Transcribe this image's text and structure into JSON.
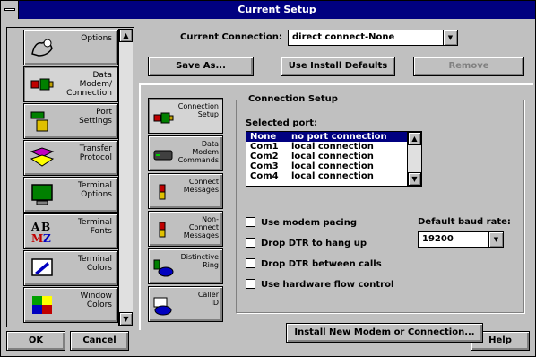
{
  "window": {
    "title": "Current Setup"
  },
  "left_panel": {
    "items": [
      {
        "label": "Options",
        "icon": "options-icon"
      },
      {
        "label": "Data\nModem/\nConnection",
        "icon": "modem-connection-icon",
        "selected": true
      },
      {
        "label": "Port\nSettings",
        "icon": "port-settings-icon"
      },
      {
        "label": "Transfer\nProtocol",
        "icon": "transfer-protocol-icon"
      },
      {
        "label": "Terminal\nOptions",
        "icon": "terminal-options-icon"
      },
      {
        "label": "Terminal\nFonts",
        "icon": "terminal-fonts-icon"
      },
      {
        "label": "Terminal\nColors",
        "icon": "terminal-colors-icon"
      },
      {
        "label": "Window\nColors",
        "icon": "window-colors-icon"
      }
    ]
  },
  "footer": {
    "ok_label": "OK",
    "cancel_label": "Cancel",
    "help_label": "Help"
  },
  "connection": {
    "label": "Current Connection:",
    "value": "direct connect-None"
  },
  "toolbar": {
    "save_as_label": "Save As...",
    "use_install_defaults_label": "Use Install Defaults",
    "remove_label": "Remove"
  },
  "inner_panel": {
    "items": [
      {
        "label": "Connection\nSetup",
        "icon": "connection-setup-icon",
        "selected": true
      },
      {
        "label": "Data\nModem\nCommands",
        "icon": "modem-commands-icon"
      },
      {
        "label": "Connect\nMessages",
        "icon": "connect-messages-icon"
      },
      {
        "label": "Non-\nConnect\nMessages",
        "icon": "non-connect-messages-icon"
      },
      {
        "label": "Distinctive\nRing",
        "icon": "distinctive-ring-icon"
      },
      {
        "label": "Caller\nID",
        "icon": "caller-id-icon"
      }
    ]
  },
  "connection_setup": {
    "group_label": "Connection Setup",
    "selected_port_label": "Selected port:",
    "ports": [
      {
        "port": "None",
        "desc": "no port connection",
        "selected": true
      },
      {
        "port": "Com1",
        "desc": "local connection"
      },
      {
        "port": "Com2",
        "desc": "local connection"
      },
      {
        "port": "Com3",
        "desc": "local connection"
      },
      {
        "port": "Com4",
        "desc": "local connection"
      }
    ],
    "use_modem_pacing": "Use modem pacing",
    "drop_dtr_hangup": "Drop DTR to hang up",
    "drop_dtr_between": "Drop DTR between calls",
    "hardware_flow": "Use hardware flow control",
    "default_baud_label": "Default baud rate:",
    "baud_value": "19200",
    "install_button_label": "Install New Modem or Connection..."
  },
  "colors": {
    "title_bar": "#000080",
    "face": "#c0c0c0",
    "selection": "#000080"
  }
}
